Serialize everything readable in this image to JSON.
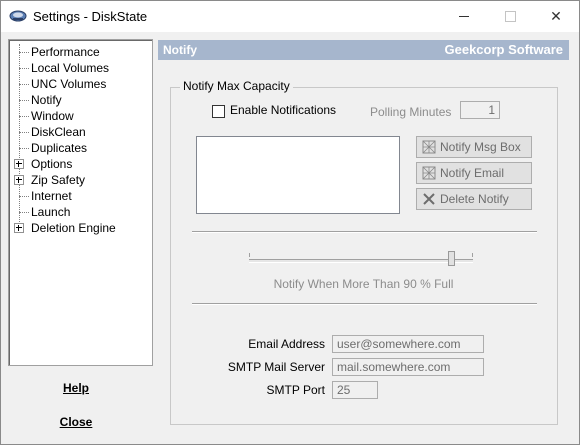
{
  "window": {
    "title": "Settings - DiskState",
    "minimize_glyph": "",
    "close_glyph": "✕"
  },
  "sidebar": {
    "items": [
      {
        "label": "Performance",
        "expandable": false
      },
      {
        "label": "Local Volumes",
        "expandable": false
      },
      {
        "label": "UNC Volumes",
        "expandable": false
      },
      {
        "label": "Notify",
        "expandable": false,
        "selected": true
      },
      {
        "label": "Window",
        "expandable": false
      },
      {
        "label": "DiskClean",
        "expandable": false
      },
      {
        "label": "Duplicates",
        "expandable": false
      },
      {
        "label": "Options",
        "expandable": true
      },
      {
        "label": "Zip Safety",
        "expandable": true
      },
      {
        "label": "Internet",
        "expandable": false
      },
      {
        "label": "Launch",
        "expandable": false
      },
      {
        "label": "Deletion Engine",
        "expandable": true
      }
    ],
    "help_label": "Help",
    "close_label": "Close"
  },
  "header": {
    "section": "Notify",
    "brand": "Geekcorp Software",
    "bar_color": "#a6b6cd"
  },
  "notify": {
    "group_title": "Notify Max Capacity",
    "enable_label": "Enable Notifications",
    "enable_checked": false,
    "polling_label": "Polling Minutes",
    "polling_value": "1",
    "buttons": {
      "msg_box": "Notify Msg Box",
      "email": "Notify Email",
      "delete": "Delete Notify"
    },
    "slider_caption": "Notify When More Than 90 % Full",
    "slider_percent": 90,
    "email_label": "Email Address",
    "email_value": "user@somewhere.com",
    "smtp_label": "SMTP Mail Server",
    "smtp_value": "mail.somewhere.com",
    "port_label": "SMTP Port",
    "port_value": "25"
  }
}
